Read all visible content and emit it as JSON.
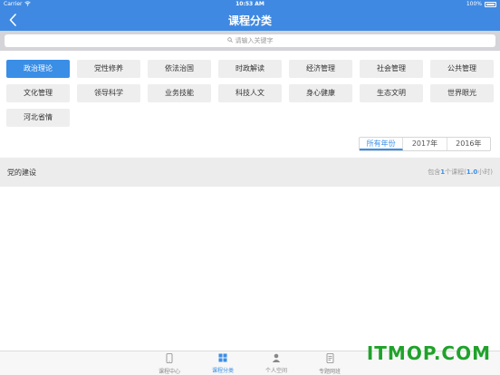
{
  "status_bar": {
    "carrier": "Carrier",
    "wifi_icon": "wifi-icon",
    "time": "10:53 AM",
    "battery": "100%"
  },
  "nav": {
    "back_icon": "chevron-left-icon",
    "title": "课程分类"
  },
  "search": {
    "placeholder": "请输入关键字",
    "icon": "search-icon"
  },
  "categories": [
    {
      "label": "政治理论",
      "active": true
    },
    {
      "label": "党性修养"
    },
    {
      "label": "依法治国"
    },
    {
      "label": "时政解读"
    },
    {
      "label": "经济管理"
    },
    {
      "label": "社会管理"
    },
    {
      "label": "公共管理"
    },
    {
      "label": "文化管理"
    },
    {
      "label": "领导科学"
    },
    {
      "label": "业务技能"
    },
    {
      "label": "科技人文"
    },
    {
      "label": "身心健康"
    },
    {
      "label": "生态文明"
    },
    {
      "label": "世界眼光"
    },
    {
      "label": "河北省情"
    }
  ],
  "year_filter": {
    "options": [
      "所有年份",
      "2017年",
      "2016年"
    ],
    "selected": "所有年份"
  },
  "section": {
    "name": "党的建设",
    "info_prefix": "包含",
    "count": "1",
    "info_mid": "个课程(",
    "hours": "1.0",
    "info_suffix": "小时)"
  },
  "tabs": [
    {
      "label": "课程中心",
      "icon": "phone-icon"
    },
    {
      "label": "课程分类",
      "icon": "grid-icon",
      "active": true
    },
    {
      "label": "个人空间",
      "icon": "person-icon"
    },
    {
      "label": "专题网班",
      "icon": "document-icon"
    }
  ],
  "watermark": "ITMOP.COM",
  "colors": {
    "primary": "#3f89e2",
    "accent": "#3a8ee6",
    "watermark": "#1fa22a"
  }
}
